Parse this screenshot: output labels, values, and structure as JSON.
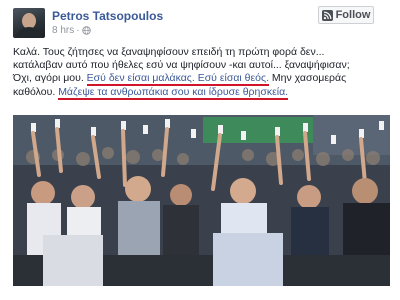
{
  "post": {
    "author_name": "Petros Tatsopoulos",
    "timestamp": "8 hrs",
    "separator": "·",
    "audience_icon": "globe-icon",
    "follow_label": "Follow",
    "follow_icon": "rss-icon",
    "text": {
      "line1": "Καλά. Τους ζήτησες να ξαναψηφίσουν επειδή τη πρώτη φορά δεν...",
      "line2": "κατάλαβαν αυτό που ήθελες εσύ να ψηφίσουν -και αυτοί... ξαναψήφισαν;",
      "line3_part1": "Όχι, αγόρι μου. ",
      "line3_highlight": "Εσύ δεν είσαι μαλάκας. Εσύ είσαι θεός.",
      "line3_part2": " Μην χασομεράς",
      "line4_part1": "καθόλου. ",
      "line4_highlight": "Μάζεψε τα ανθρωπάκια σου και ίδρυσε θρησκεία."
    },
    "photo": {
      "icon": "crowd-photo"
    }
  },
  "colors": {
    "link_blue": "#3b5998",
    "underline_red": "#d0152a",
    "text_dark": "#1d2129",
    "meta_gray": "#90949c"
  }
}
